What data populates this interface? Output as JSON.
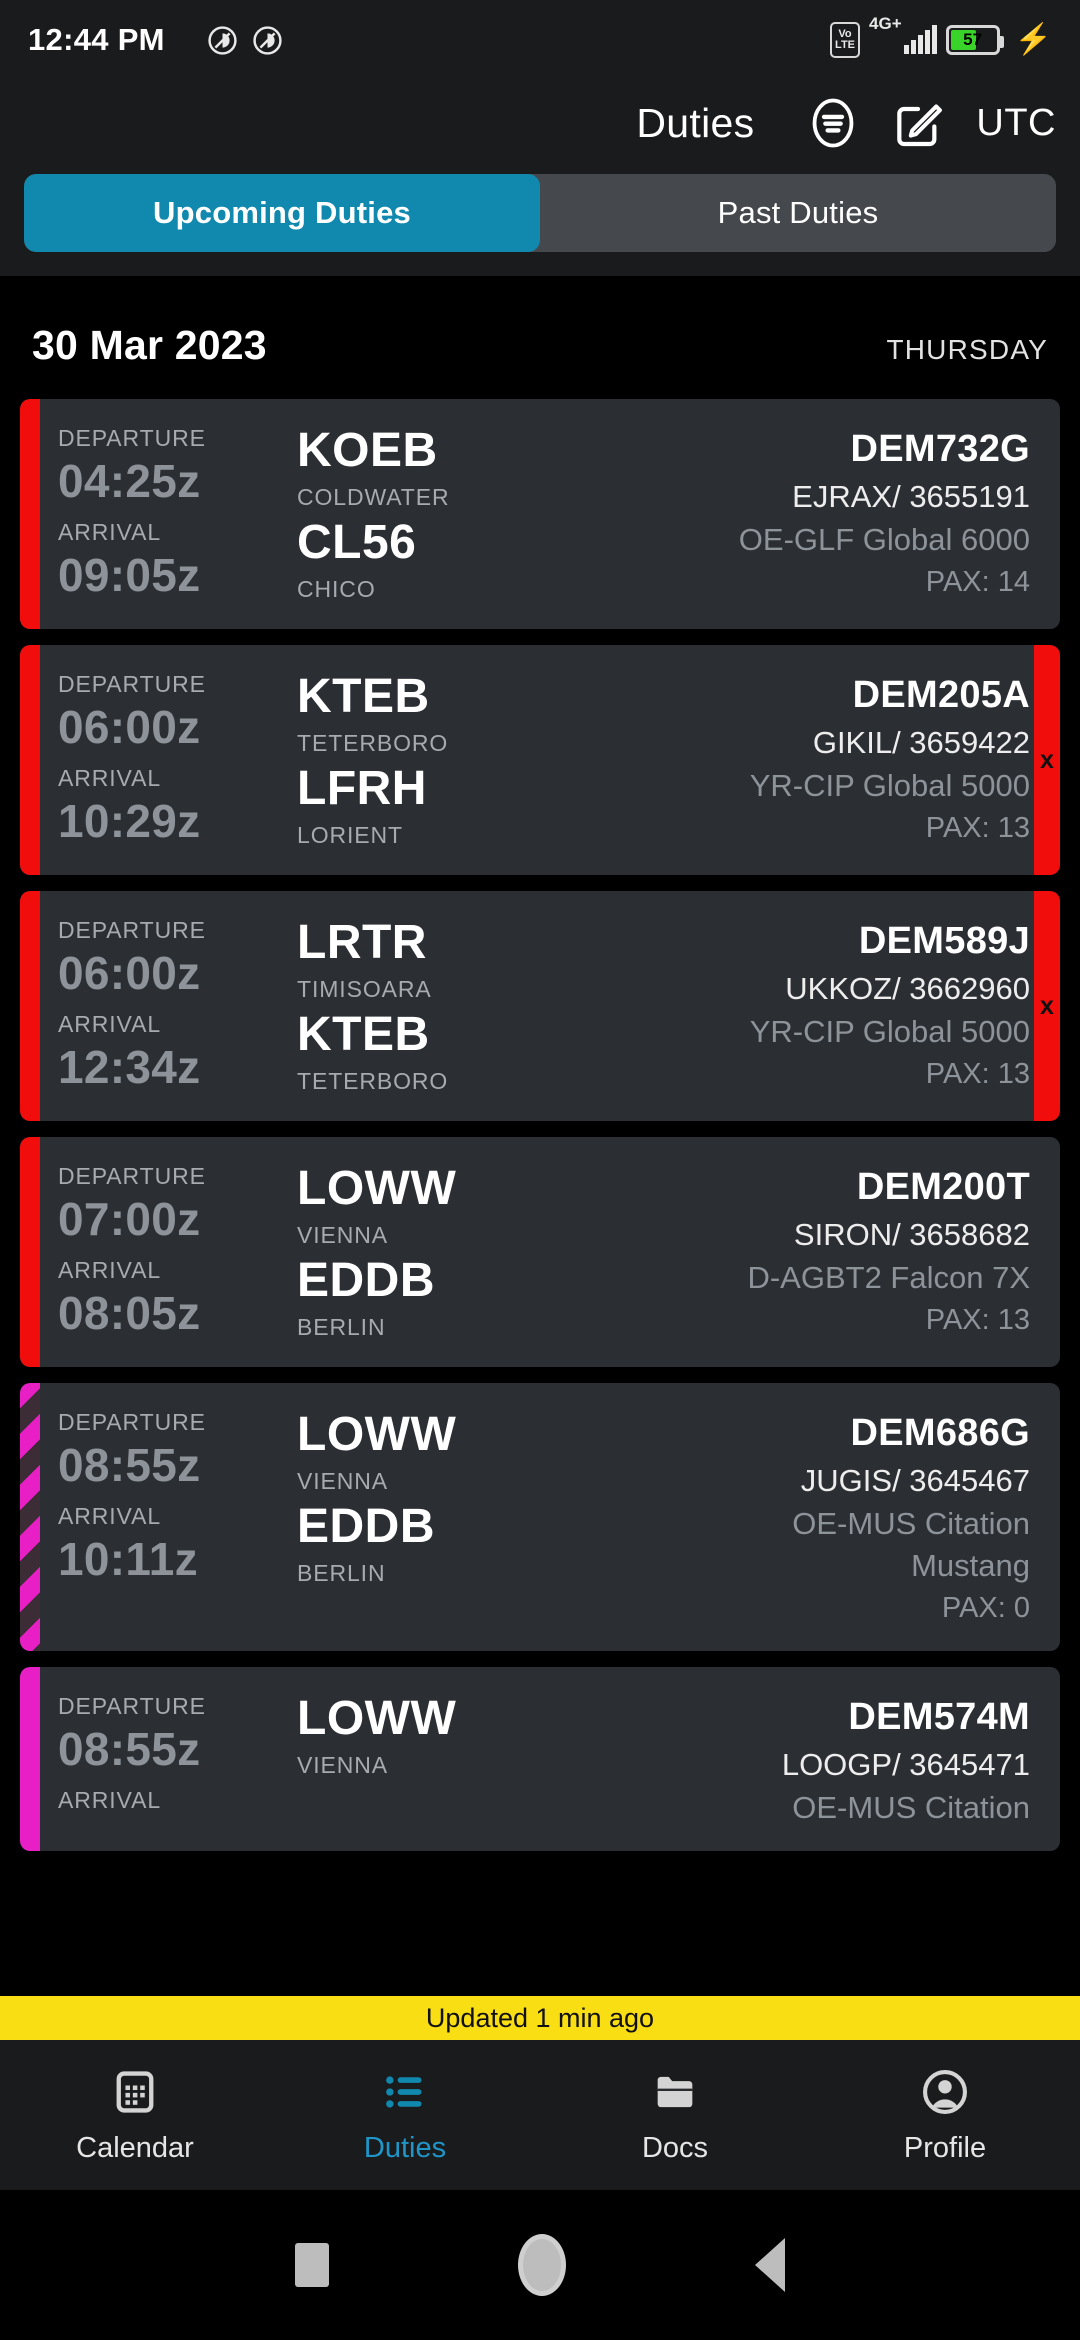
{
  "statusbar": {
    "time": "12:44 PM",
    "icons": [
      "dnd-icon",
      "dnd-icon"
    ],
    "volte_top": "Vo",
    "volte_bottom": "LTE",
    "network": "4G+",
    "battery_percent": "57",
    "battery_level": 57
  },
  "header": {
    "title": "Duties",
    "filter_icon": "filter-icon",
    "compose_icon": "compose-icon",
    "timezone": "UTC"
  },
  "tabs": [
    {
      "label": "Upcoming Duties",
      "active": true
    },
    {
      "label": "Past Duties",
      "active": false
    }
  ],
  "date_header": {
    "date": "30 Mar 2023",
    "day_of_week": "THURSDAY"
  },
  "labels": {
    "departure": "DEPARTURE",
    "arrival": "ARRIVAL"
  },
  "duties": [
    {
      "departure_time": "04:25z",
      "arrival_time": "09:05z",
      "departure_code": "KOEB",
      "departure_city": "COLDWATER",
      "arrival_code": "CL56",
      "arrival_city": "CHICO",
      "flight_no": "DEM732G",
      "route_ref": "EJRAX/ 3655191",
      "aircraft": "OE-GLF Global 6000",
      "pax": "PAX: 14",
      "left_bar": "red",
      "right_bar": "none",
      "right_mark": ""
    },
    {
      "departure_time": "06:00z",
      "arrival_time": "10:29z",
      "departure_code": "KTEB",
      "departure_city": "TETERBORO",
      "arrival_code": "LFRH",
      "arrival_city": "LORIENT",
      "flight_no": "DEM205A",
      "route_ref": "GIKIL/ 3659422",
      "aircraft": "YR-CIP Global 5000",
      "pax": "PAX: 13",
      "left_bar": "red",
      "right_bar": "red",
      "right_mark": "x"
    },
    {
      "departure_time": "06:00z",
      "arrival_time": "12:34z",
      "departure_code": "LRTR",
      "departure_city": "TIMISOARA",
      "arrival_code": "KTEB",
      "arrival_city": "TETERBORO",
      "flight_no": "DEM589J",
      "route_ref": "UKKOZ/ 3662960",
      "aircraft": "YR-CIP Global 5000",
      "pax": "PAX: 13",
      "left_bar": "red",
      "right_bar": "red",
      "right_mark": "x"
    },
    {
      "departure_time": "07:00z",
      "arrival_time": "08:05z",
      "departure_code": "LOWW",
      "departure_city": "VIENNA",
      "arrival_code": "EDDB",
      "arrival_city": "BERLIN",
      "flight_no": "DEM200T",
      "route_ref": "SIRON/ 3658682",
      "aircraft": "D-AGBT2 Falcon 7X",
      "pax": "PAX: 13",
      "left_bar": "red",
      "right_bar": "none",
      "right_mark": ""
    },
    {
      "departure_time": "08:55z",
      "arrival_time": "10:11z",
      "departure_code": "LOWW",
      "departure_city": "VIENNA",
      "arrival_code": "EDDB",
      "arrival_city": "BERLIN",
      "flight_no": "DEM686G",
      "route_ref": "JUGIS/ 3645467",
      "aircraft": "OE-MUS Citation Mustang",
      "pax": "PAX: 0",
      "left_bar": "magenta-striped",
      "right_bar": "none",
      "right_mark": ""
    },
    {
      "departure_time": "08:55z",
      "arrival_time": "",
      "departure_code": "LOWW",
      "departure_city": "VIENNA",
      "arrival_code": "",
      "arrival_city": "",
      "flight_no": "DEM574M",
      "route_ref": "LOOGP/ 3645471",
      "aircraft": "OE-MUS Citation",
      "pax": "",
      "left_bar": "magenta",
      "right_bar": "none",
      "right_mark": ""
    }
  ],
  "updated_banner": "Updated 1 min ago",
  "bottom_nav": [
    {
      "label": "Calendar",
      "icon": "calendar-icon",
      "active": false
    },
    {
      "label": "Duties",
      "icon": "list-icon",
      "active": true
    },
    {
      "label": "Docs",
      "icon": "folder-icon",
      "active": false
    },
    {
      "label": "Profile",
      "icon": "person-icon",
      "active": false
    }
  ],
  "android_nav": [
    "recents-square-icon",
    "home-circle-icon",
    "back-triangle-icon"
  ],
  "colors": {
    "accent": "#1189ae",
    "alert_red": "#f20d0d",
    "magenta": "#e81fc4",
    "banner_yellow": "#fade14",
    "card_bg": "#2b2f34"
  }
}
